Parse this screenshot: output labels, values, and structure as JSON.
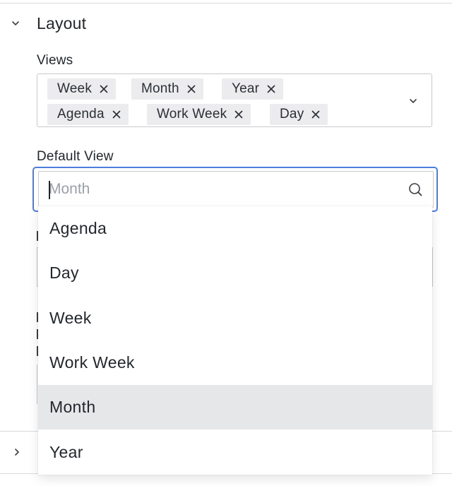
{
  "section": {
    "title": "Layout",
    "expanded_icon": "chevron-down-icon"
  },
  "views": {
    "label": "Views",
    "chips": [
      {
        "label": "Week"
      },
      {
        "label": "Month"
      },
      {
        "label": "Year"
      },
      {
        "label": "Agenda"
      },
      {
        "label": "Work Week"
      },
      {
        "label": "Day"
      }
    ],
    "remove_icon": "close-icon",
    "dropdown_icon": "chevron-down-icon"
  },
  "default_view": {
    "label": "Default View",
    "placeholder": "Month",
    "value": "",
    "search_icon": "search-icon",
    "options": [
      {
        "label": "Agenda",
        "selected": false
      },
      {
        "label": "Day",
        "selected": false
      },
      {
        "label": "Week",
        "selected": false
      },
      {
        "label": "Work Week",
        "selected": false
      },
      {
        "label": "Month",
        "selected": true
      },
      {
        "label": "Year",
        "selected": false
      }
    ]
  },
  "colors": {
    "focus_border": "#4c7ddb",
    "chip_bg": "#ececee",
    "selected_option_bg": "#e6e7e9"
  }
}
